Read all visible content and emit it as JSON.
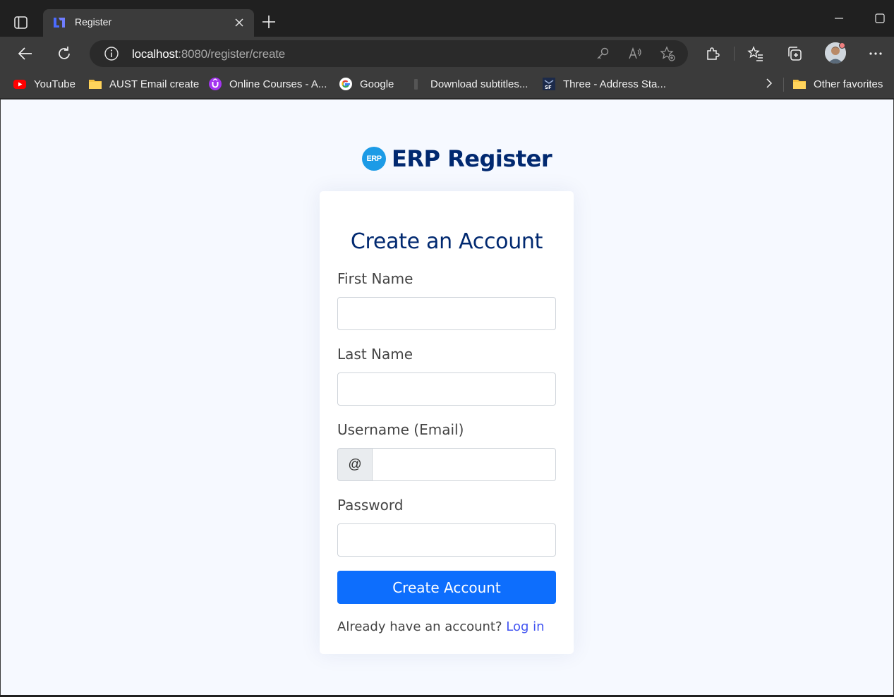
{
  "browser": {
    "tab": {
      "title": "Register"
    },
    "address": {
      "host": "localhost",
      "rest": ":8080/register/create"
    },
    "favorites": [
      {
        "label": "YouTube",
        "icon": "youtube-icon"
      },
      {
        "label": "AUST Email create",
        "icon": "folder-icon"
      },
      {
        "label": "Online Courses - A...",
        "icon": "udemy-icon"
      },
      {
        "label": "Google",
        "icon": "google-icon"
      },
      {
        "label": "Download subtitles...",
        "icon": "bookmark-icon"
      },
      {
        "label": "Three - Address Sta...",
        "icon": "sf-icon"
      }
    ],
    "other_favorites": "Other favorites"
  },
  "page": {
    "brand": {
      "logo_text": "ERP",
      "title": "ERP Register"
    },
    "card_title": "Create an Account",
    "fields": {
      "first_name": {
        "label": "First Name",
        "value": ""
      },
      "last_name": {
        "label": "Last Name",
        "value": ""
      },
      "username": {
        "label": "Username (Email)",
        "prefix": "@",
        "value": ""
      },
      "password": {
        "label": "Password",
        "value": ""
      }
    },
    "submit_label": "Create Account",
    "footer": {
      "text": "Already have an account?",
      "link": "Log in"
    }
  },
  "colors": {
    "brand_navy": "#012970",
    "primary_button": "#0d6efd",
    "link": "#4154f1",
    "page_bg": "#f6f9ff"
  }
}
